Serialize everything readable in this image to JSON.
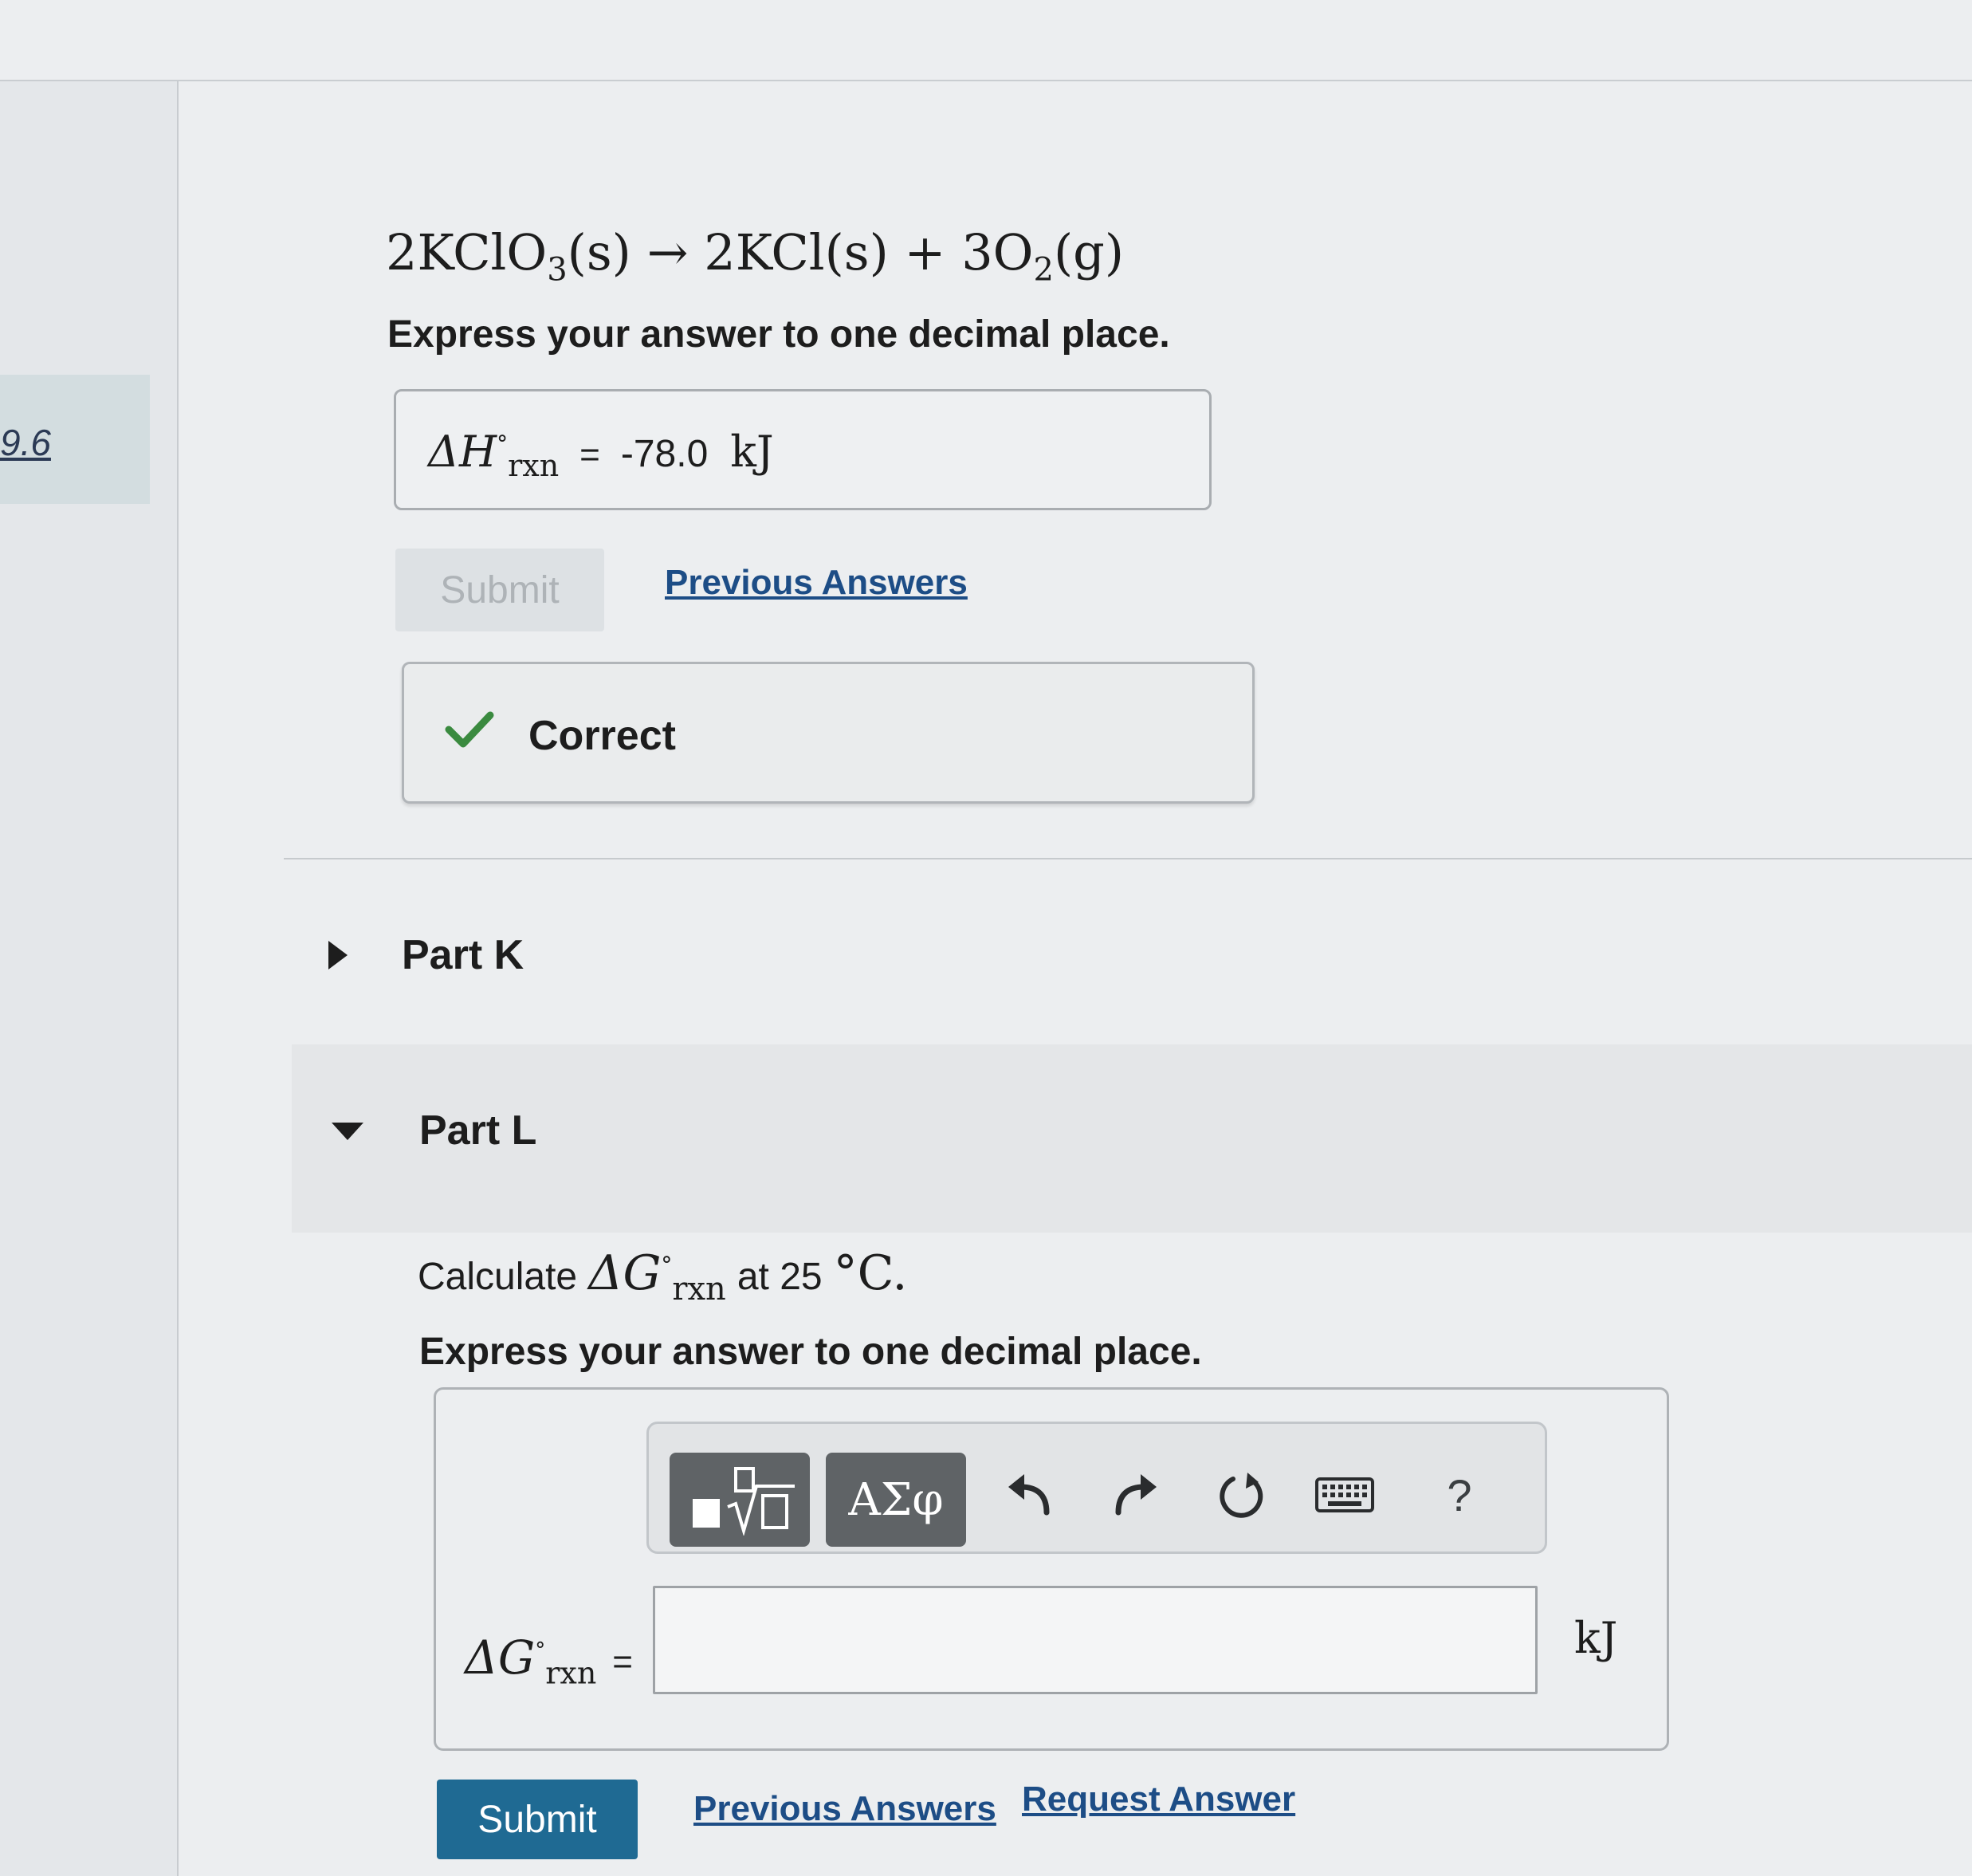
{
  "nav": {
    "current_item": "9.6"
  },
  "part_j": {
    "equation": {
      "lhs_coef": "2KClO",
      "lhs_sub": "3",
      "lhs_state": "(s)",
      "arrow": "→",
      "p1": "2KCl(s)",
      "plus": "+",
      "p2_coef": "3O",
      "p2_sub": "2",
      "p2_state": "(g)"
    },
    "instruction": "Express your answer to one decimal place.",
    "answer": {
      "symbol_main": "ΔH",
      "symbol_sup": "°",
      "symbol_sub": "rxn",
      "equals": "=",
      "value": "-78.0",
      "unit": "kJ"
    },
    "submit_label": "Submit",
    "previous_answers_label": "Previous Answers",
    "feedback": {
      "label": "Correct",
      "check_color": "#3a8a3f"
    }
  },
  "part_k": {
    "label": "Part K",
    "expanded": false
  },
  "part_l": {
    "label": "Part L",
    "expanded": true,
    "prompt": {
      "prefix": "Calculate",
      "symbol_main": "ΔG",
      "symbol_sup": "°",
      "symbol_sub": "rxn",
      "mid": "at 25",
      "degree": "°",
      "unit": "C."
    },
    "instruction": "Express your answer to one decimal place.",
    "toolbar": {
      "templates_icon": "templates-icon",
      "greek_label": "ΑΣφ",
      "undo_icon": "undo-icon",
      "redo_icon": "redo-icon",
      "reset_icon": "reset-icon",
      "keyboard_icon": "keyboard-icon",
      "help_label": "?"
    },
    "answer": {
      "symbol_main": "ΔG",
      "symbol_sup": "°",
      "symbol_sub": "rxn",
      "equals": "=",
      "value": "",
      "unit": "kJ"
    },
    "submit_label": "Submit",
    "previous_answers_label": "Previous Answers",
    "request_answer_label": "Request Answer"
  },
  "colors": {
    "primary_button": "#1f6a93",
    "link": "#1d4d86",
    "toolbar_button": "#5f6366"
  }
}
